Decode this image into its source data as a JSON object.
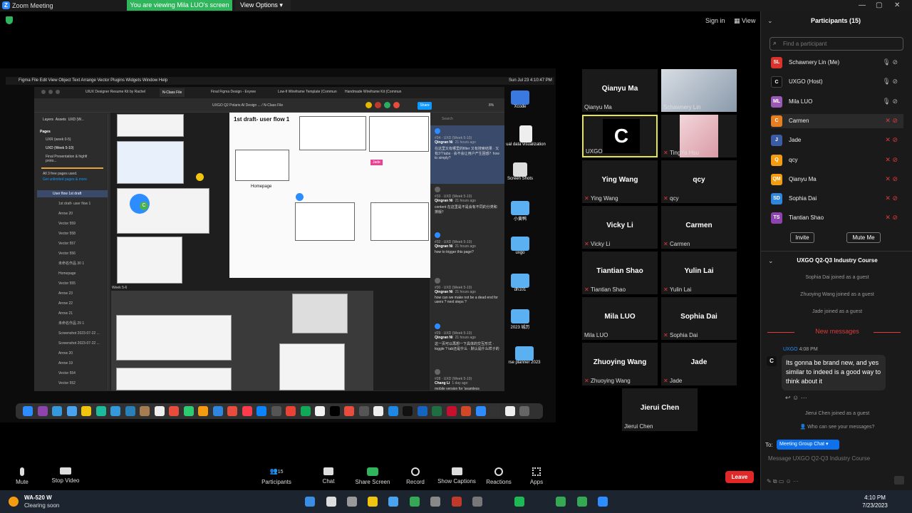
{
  "window": {
    "title": "Zoom Meeting",
    "viewing_banner": "You are viewing Mila LUO's screen",
    "view_options": "View Options",
    "sign_in": "Sign in",
    "view": "View"
  },
  "share": {
    "menubar": [
      "Figma",
      "File",
      "Edit",
      "View",
      "Object",
      "Text",
      "Arrange",
      "Vector",
      "Plugins",
      "Widgets",
      "Window",
      "Help"
    ],
    "clock": "Sun Jul 23  4:10:47 PM",
    "tabs": [
      "UIUX Designer Resume Kit by Rachel",
      "N-Class File",
      "Final Figma Design - Evyree",
      "Low-fi Wireframe Template (Commun",
      "Handmade Wireframe Kit (Commun"
    ],
    "file_title": "UXGO Q2 Polaris AI Design ... / N-Class File",
    "share_btn": "Share",
    "zoom": "8%",
    "left_tabs": [
      "Layers",
      "Assets",
      "UXD (W..."
    ],
    "pages_label": "Pages",
    "pages": [
      "UXR (week 0-5)",
      "UXD (Week 5-10)",
      "Final Presentation & highfi proto..."
    ],
    "pages_used": "All 3 free pages used.",
    "unlimited": "Get unlimited pages & more",
    "layers": [
      "User flow 1st draft",
      "1st draft- user flow 1",
      "Arrow 20",
      "Vector 559",
      "Vector 558",
      "Vector 557",
      "Vector 556",
      "未命名作品 30 1",
      "Homepage",
      "Vector 555",
      "Arrow 23",
      "Arrow 22",
      "Arrow 21",
      "未命名作品 29 1",
      "Screenshot 2023-07-22 ...",
      "Screenshot 2023-07-22 ...",
      "Arrow 20",
      "Arrow 19",
      "Vector 554",
      "Vector 552"
    ],
    "canvas_title": "1st draft- user flow 1",
    "homepage_label": "Homepage",
    "jade_tag": "Jade",
    "week_label": "Week 5-6",
    "comments": [
      {
        "id": "#34 · UXD (Week 5-10)",
        "author": "Qingran Ni",
        "time": "21 hours ago",
        "text": "在这里又有哪里的filter 又有搜索结果 · 又有3个tabs · 会不会让用户产生困惑？how to simply?"
      },
      {
        "id": "#33 · UXD (Week 5-10)",
        "author": "Qingran Ni",
        "time": "21 hours ago",
        "text": "content 在这里是不是会有不同的分类和排版？"
      },
      {
        "id": "#32 · UXD (Week 5-10)",
        "author": "Qingran Ni",
        "time": "21 hours ago",
        "text": "how to trigger this page?"
      },
      {
        "id": "#30 · UXD (Week 5-10)",
        "author": "Qingran Ni",
        "time": "21 hours ago",
        "text": "how can we make not be a dead end for users ? next steps ?"
      },
      {
        "id": "#29 · UXD (Week 5-10)",
        "author": "Qingran Ni",
        "time": "21 hours ago",
        "text": "这一页可以再想一下具体的交互形式 · toggle ? tab还是什么 · 默认是什么样子的"
      },
      {
        "id": "#28 · UXD (Week 5-10)",
        "author": "Chang Li",
        "time": "1 day ago",
        "text": "mobile version for 'seamless"
      }
    ],
    "comment_search": "Search",
    "desktop": [
      "Xcode",
      "ual data visualization",
      "Screen Shots",
      "小黄鸭",
      "uxgo",
      "dh101",
      "2023 城历",
      "rse planner 2023"
    ]
  },
  "gallery": [
    {
      "big": "Qianyu Ma",
      "small": "Qianyu Ma",
      "muted": false,
      "video": false
    },
    {
      "big": "",
      "small": "Schawnery Lin",
      "muted": false,
      "video": true
    },
    {
      "big": "",
      "small": "UXGO",
      "muted": false,
      "video": false,
      "logo": "C"
    },
    {
      "big": "",
      "small": "TingYa Hsu",
      "muted": true,
      "video": true
    },
    {
      "big": "Ying Wang",
      "small": "Ying Wang",
      "muted": true
    },
    {
      "big": "qcy",
      "small": "qcy",
      "muted": true
    },
    {
      "big": "Vicky Li",
      "small": "Vicky Li",
      "muted": true
    },
    {
      "big": "Carmen",
      "small": "Carmen",
      "muted": true
    },
    {
      "big": "Tiantian Shao",
      "small": "Tiantian Shao",
      "muted": true
    },
    {
      "big": "Yulin Lai",
      "small": "Yulin Lai",
      "muted": true
    },
    {
      "big": "Mila LUO",
      "small": "Mila LUO",
      "muted": false
    },
    {
      "big": "Sophia Dai",
      "small": "Sophia Dai",
      "muted": true
    },
    {
      "big": "Zhuoying Wang",
      "small": "Zhuoying Wang",
      "muted": true
    },
    {
      "big": "Jade",
      "small": "Jade",
      "muted": true
    },
    {
      "big": "Jierui Chen",
      "small": "Jierui Chen",
      "muted": false
    }
  ],
  "participants": {
    "title": "Participants (15)",
    "search_placeholder": "Find a participant",
    "list": [
      {
        "initials": "SL",
        "name": "Schawnery Lin (Me)",
        "color": "#d9332c"
      },
      {
        "initials": "C",
        "name": "UXGO (Host)",
        "color": "#111111"
      },
      {
        "initials": "ML",
        "name": "Mila LUO",
        "color": "#9b59b6"
      },
      {
        "initials": "C",
        "name": "Carmen",
        "color": "#e67e22"
      },
      {
        "initials": "J",
        "name": "Jade",
        "color": "#3b5ba5"
      },
      {
        "initials": "Q",
        "name": "qcy",
        "color": "#f39c12"
      },
      {
        "initials": "QM",
        "name": "Qianyu Ma",
        "color": "#f39c12"
      },
      {
        "initials": "SD",
        "name": "Sophia Dai",
        "color": "#2e86de"
      },
      {
        "initials": "TS",
        "name": "Tiantian Shao",
        "color": "#8e44ad"
      }
    ],
    "invite": "Invite",
    "mute_me": "Mute Me"
  },
  "chat": {
    "title": "UXGO Q2-Q3 Industry Course",
    "system": [
      "Sophia Dai joined as a guest",
      "Zhuoying Wang joined as a guest",
      "Jade joined as a guest"
    ],
    "new_messages": "New messages",
    "sender": "UXGO",
    "time": "4:08 PM",
    "message": "Its gonna be brand new, and yes similar to indeed is a good way to think about it",
    "after": "Jierui Chen joined as a guest",
    "who_can_see": "Who can see your messages?",
    "to_label": "To:",
    "to_value": "Meeting Group Chat",
    "placeholder": "Message UXGO Q2-Q3 Industry Course"
  },
  "toolbar": {
    "mute": "Mute",
    "stop_video": "Stop Video",
    "participants": "Participants",
    "participants_count": "15",
    "chat": "Chat",
    "share_screen": "Share Screen",
    "record": "Record",
    "show_captions": "Show Captions",
    "reactions": "Reactions",
    "apps": "Apps",
    "leave": "Leave"
  },
  "taskbar": {
    "weather_title": "WA-520 W",
    "weather_sub": "Clearing soon",
    "time": "4:10 PM",
    "date": "7/23/2023"
  }
}
